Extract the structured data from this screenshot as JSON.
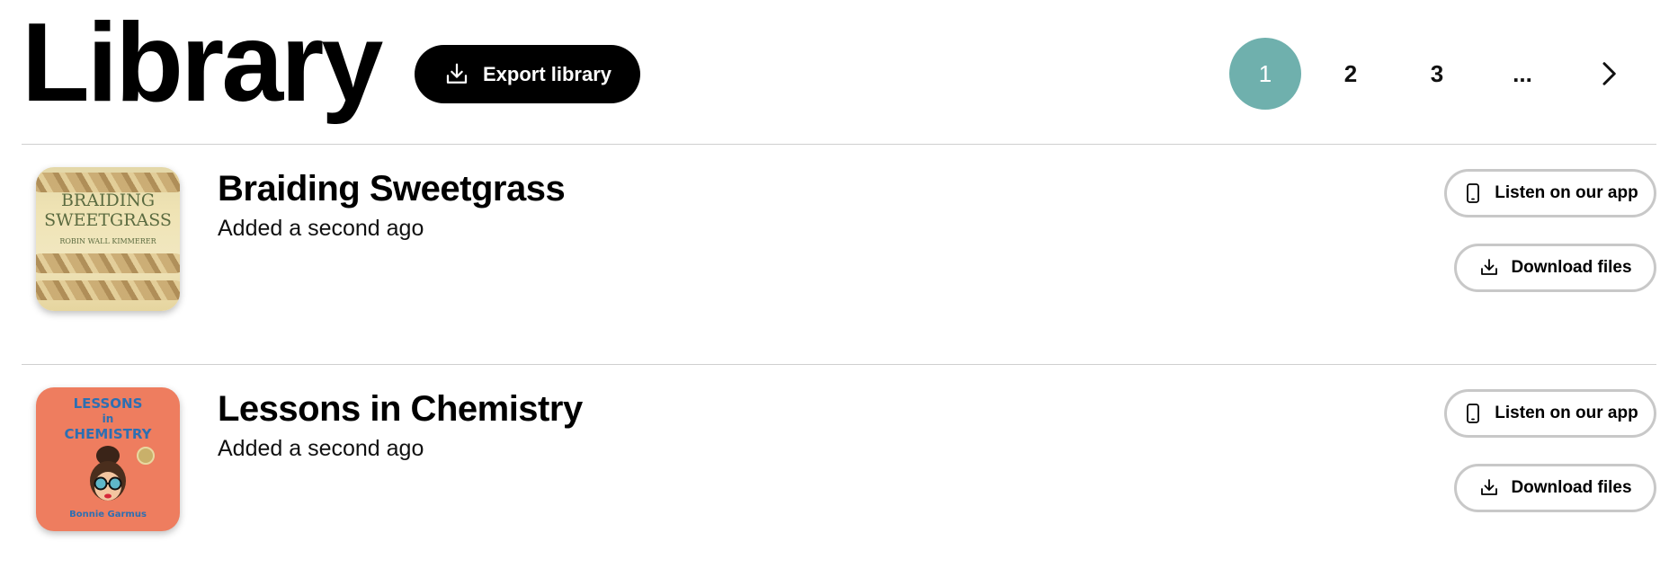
{
  "header": {
    "title": "Library",
    "export_label": "Export library"
  },
  "pagination": {
    "pages": [
      "1",
      "2",
      "3",
      "..."
    ],
    "active": "1",
    "next_icon": "chevron-right-icon"
  },
  "colors": {
    "accent": "#6fb0ad",
    "primary_button": "#000000",
    "border": "#c8c8c8"
  },
  "books": [
    {
      "title": "Braiding Sweetgrass",
      "added": "Added a second ago",
      "cover_lines": [
        "BRAIDING",
        "SWEETGRASS"
      ],
      "cover_author": "ROBIN WALL KIMMERER",
      "listen_label": "Listen on our app",
      "download_label": "Download files"
    },
    {
      "title": "Lessons in Chemistry",
      "added": "Added a second ago",
      "cover_lines": [
        "LESSONS",
        "in",
        "CHEMISTRY"
      ],
      "cover_author": "Bonnie Garmus",
      "listen_label": "Listen on our app",
      "download_label": "Download files"
    }
  ]
}
